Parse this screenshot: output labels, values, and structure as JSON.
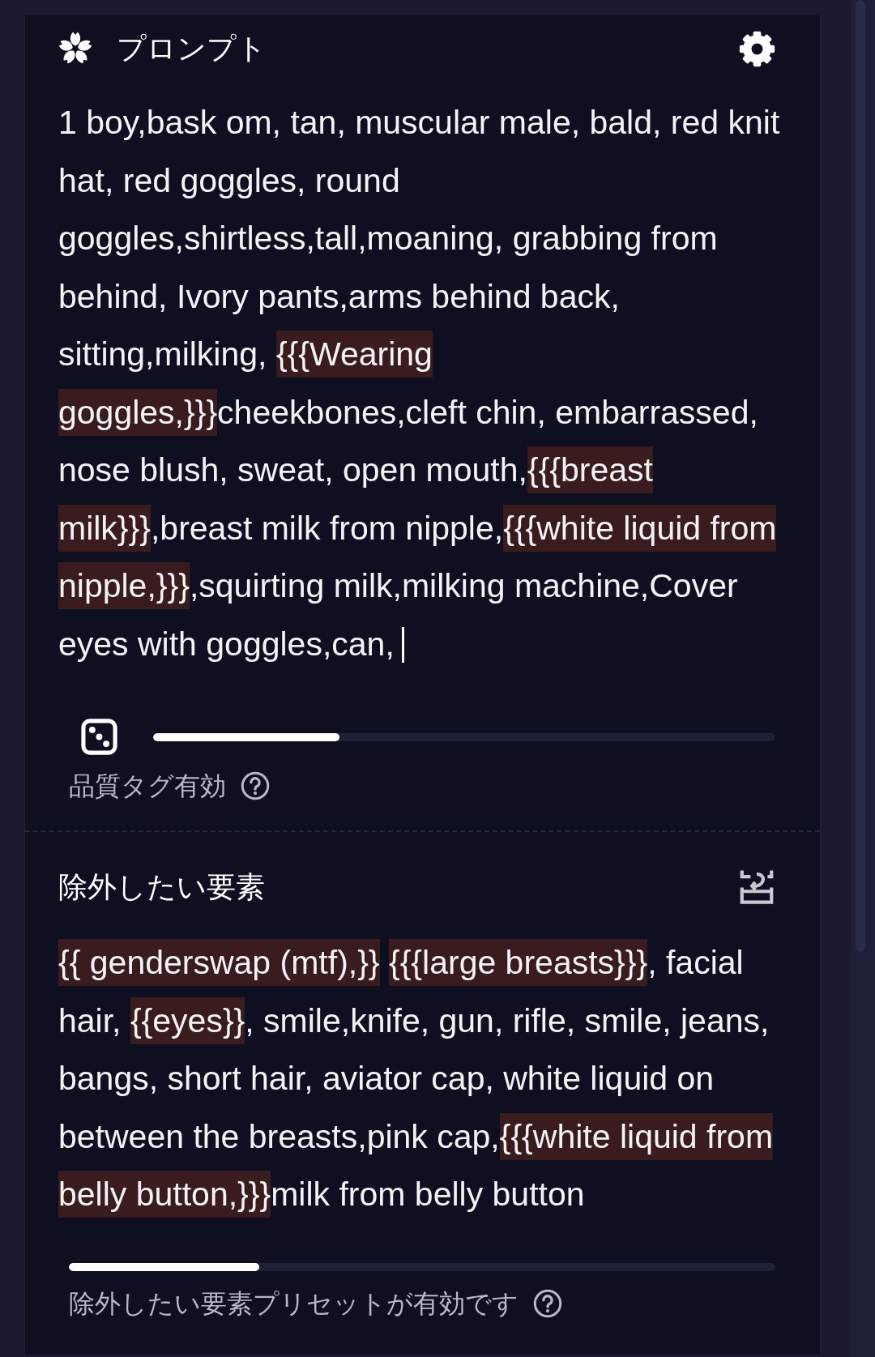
{
  "prompt_editor": {
    "title": "プロンプト",
    "focused": true,
    "segments": [
      {
        "text": "1 boy,bask om, tan, muscular male, bald, red knit hat, red goggles, round goggles,shirtless,tall,moaning, grabbing from behind, Ivory pants,arms behind back, sitting,milking, ",
        "emphasized": false
      },
      {
        "text": "{{{Wearing goggles,}}}",
        "emphasized": true
      },
      {
        "text": "cheekbones,cleft chin, embarrassed, nose blush, sweat, open mouth,",
        "emphasized": false
      },
      {
        "text": "{{{breast milk}}}",
        "emphasized": true
      },
      {
        "text": ",breast milk from nipple,",
        "emphasized": false
      },
      {
        "text": "{{{white liquid from nipple,}}}",
        "emphasized": true
      },
      {
        "text": ",squirting milk,milking machine,Cover eyes with goggles,can,",
        "emphasized": false
      }
    ],
    "slider": {
      "level": 0.3
    },
    "quality_tags_label": "品質タグ有効"
  },
  "undesired_content": {
    "title": "除外したい要素",
    "segments": [
      {
        "text": "{{ genderswap (mtf),}} ",
        "emphasized": true
      },
      {
        "text": "{{{large breasts}}}",
        "emphasized": true
      },
      {
        "text": ", facial hair, ",
        "emphasized": false
      },
      {
        "text": "{{eyes}}",
        "emphasized": true
      },
      {
        "text": ", smile,knife, gun, rifle, smile, jeans, bangs, short hair, aviator cap, white liquid on between the breasts,pink cap,",
        "emphasized": false
      },
      {
        "text": "{{{white liquid from belly button,}}}",
        "emphasized": true
      },
      {
        "text": "milk from belly button",
        "emphasized": false
      }
    ],
    "slider": {
      "level": 0.27
    },
    "preset_label": "除外したい要素プリセットが有効です"
  }
}
